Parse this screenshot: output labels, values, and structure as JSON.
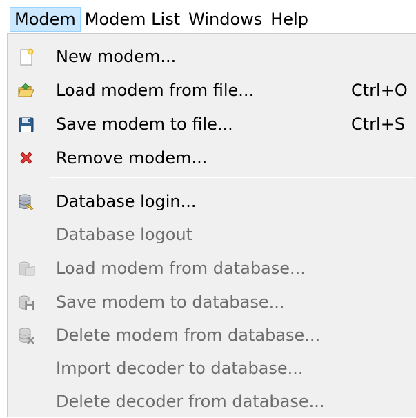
{
  "menubar": {
    "items": [
      {
        "label": "Modem"
      },
      {
        "label": "Modem List"
      },
      {
        "label": "Windows"
      },
      {
        "label": "Help"
      }
    ]
  },
  "modem_menu": {
    "items": [
      {
        "label": "New modem...",
        "shortcut": "",
        "icon": "new-document-icon",
        "enabled": true
      },
      {
        "label": "Load modem from file...",
        "shortcut": "Ctrl+O",
        "icon": "open-folder-icon",
        "enabled": true
      },
      {
        "label": "Save modem to file...",
        "shortcut": "Ctrl+S",
        "icon": "floppy-disk-icon",
        "enabled": true
      },
      {
        "label": "Remove modem...",
        "shortcut": "",
        "icon": "red-x-icon",
        "enabled": true
      },
      {
        "label": "Database login...",
        "shortcut": "",
        "icon": "database-login-icon",
        "enabled": true
      },
      {
        "label": "Database logout",
        "shortcut": "",
        "icon": "",
        "enabled": false
      },
      {
        "label": "Load modem from database...",
        "shortcut": "",
        "icon": "database-load-icon",
        "enabled": false
      },
      {
        "label": "Save modem to database...",
        "shortcut": "",
        "icon": "database-save-icon",
        "enabled": false
      },
      {
        "label": "Delete modem from database...",
        "shortcut": "",
        "icon": "database-delete-icon",
        "enabled": false
      },
      {
        "label": "Import decoder to database...",
        "shortcut": "",
        "icon": "",
        "enabled": false
      },
      {
        "label": "Delete decoder from database...",
        "shortcut": "",
        "icon": "",
        "enabled": false
      }
    ]
  },
  "colors": {
    "menu_background": "#f0f0f0",
    "active_menu_highlight": "#cce8ff",
    "active_menu_border": "#99d1ff",
    "disabled_text": "#6d6d6d"
  }
}
